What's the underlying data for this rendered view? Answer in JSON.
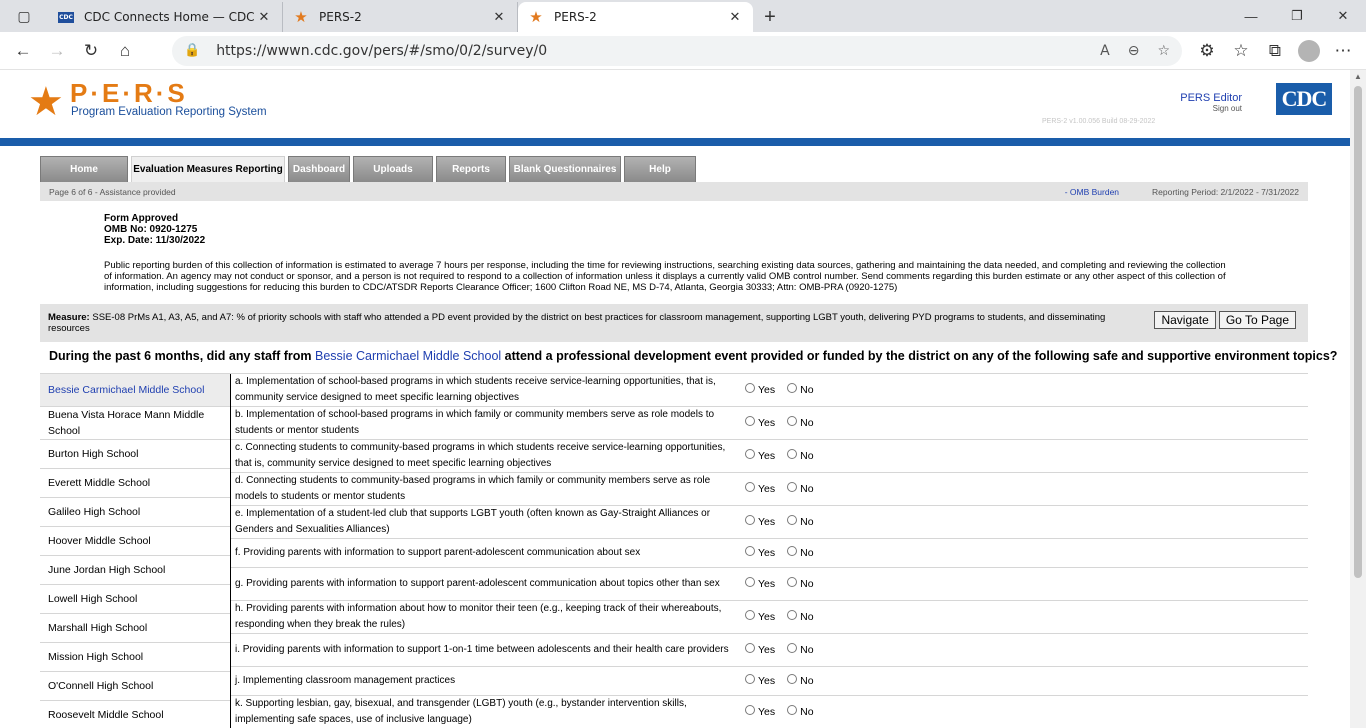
{
  "browser": {
    "tabs": [
      {
        "title": "CDC Connects Home — CDC Co",
        "icon": "cdc-favicon",
        "active": false
      },
      {
        "title": "PERS-2",
        "icon": "star-icon",
        "active": false
      },
      {
        "title": "PERS-2",
        "icon": "star-icon",
        "active": true
      }
    ],
    "url": "https://wwwn.cdc.gov/pers/#/smo/0/2/survey/0"
  },
  "header": {
    "logo_text": "P·E·R·S",
    "logo_subtitle": "Program Evaluation Reporting System",
    "editor_link": "PERS Editor",
    "sign_out": "Sign out",
    "version": "PERS-2 v1.00.056    Build 08-29-2022",
    "cdc_logo": "CDC"
  },
  "nav": {
    "tabs": [
      "Home",
      "Evaluation Measures Reporting",
      "Dashboard",
      "Uploads",
      "Reports",
      "Blank Questionnaires",
      "Help"
    ],
    "active": "Evaluation Measures Reporting"
  },
  "subbar": {
    "page": "Page 6 of 6 - Assistance provided",
    "omb_link": "- OMB Burden",
    "period": "Reporting Period: 2/1/2022 - 7/31/2022"
  },
  "form": {
    "approved": "Form Approved",
    "omb_no": "OMB No: 0920-1275",
    "exp": "Exp. Date: 11/30/2022",
    "burden": "Public reporting burden of this collection of information is estimated to average 7 hours per response, including the time for reviewing instructions, searching existing data sources, gathering and maintaining the data needed, and completing and reviewing the collection of information. An agency may not conduct or sponsor, and a person is not required to respond to a collection of information unless it displays a currently valid OMB control number. Send comments regarding this burden estimate or any other aspect of this collection of information, including suggestions for reducing this burden to CDC/ATSDR Reports Clearance Officer; 1600 Clifton Road NE, MS D-74, Atlanta, Georgia 30333; Attn: OMB-PRA (0920-1275)"
  },
  "measure": {
    "label": "Measure:",
    "text": " SSE-08 PrMs A1, A3, A5, and A7: % of priority schools with staff who attended a PD event provided by the district on best practices for classroom management, supporting LGBT youth, delivering PYD programs to students, and disseminating resources",
    "navigate_button": "Navigate",
    "goto_button": "Go To Page"
  },
  "question": {
    "prefix": "During the past 6 months, did any staff from ",
    "school": "Bessie Carmichael Middle School",
    "suffix": " attend a professional development event provided or funded by the district on any of the following safe and supportive environment topics?"
  },
  "schools": [
    "Bessie Carmichael Middle School",
    "Buena Vista Horace Mann Middle School",
    "Burton High School",
    "Everett Middle School",
    "Galileo High School",
    "Hoover Middle School",
    "June Jordan High School",
    "Lowell High School",
    "Marshall High School",
    "Mission High School",
    "O'Connell High School",
    "Roosevelt Middle School"
  ],
  "selected_school": "Bessie Carmichael Middle School",
  "items": [
    "a. Implementation of school-based programs in which students receive service-learning opportunities, that is, community service designed to meet specific learning objectives",
    "b. Implementation of school-based programs in which family or community members serve as role models to students or mentor students",
    "c. Connecting students to community-based programs in which students receive service-learning opportunities, that is, community service designed to meet specific learning objectives",
    "d. Connecting students to community-based programs in which family or community members serve as role models to students or mentor students",
    "e. Implementation of a student-led club that supports LGBT youth (often known as Gay-Straight Alliances or Genders and Sexualities Alliances)",
    "f. Providing parents with information to support parent-adolescent communication about sex",
    "g. Providing parents with information to support parent-adolescent communication about topics other than sex",
    "h. Providing parents with information about how to monitor their teen (e.g., keeping track of their whereabouts, responding when they break the rules)",
    "i. Providing parents with information to support 1-on-1 time between adolescents and their health care providers",
    "j. Implementing classroom management practices",
    "k. Supporting lesbian, gay, bisexual, and transgender (LGBT) youth (e.g., bystander intervention skills, implementing safe spaces, use of inclusive language)"
  ],
  "options": {
    "yes": "Yes",
    "no": "No"
  }
}
